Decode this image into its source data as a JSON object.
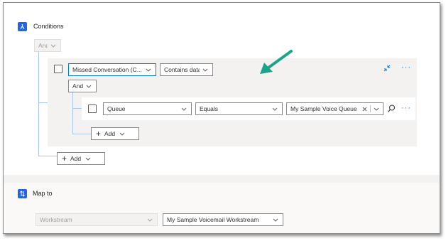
{
  "conditions": {
    "title": "Conditions",
    "top_operator": "And",
    "add_button_label": "Add",
    "group": {
      "field_value": "Missed Conversation (C...",
      "operator_value": "Contains data",
      "inner_operator": "And",
      "add_button_label": "Add",
      "row": {
        "field_value": "Queue",
        "operator_value": "Equals",
        "value_tag": "My Sample Voice Queue"
      }
    }
  },
  "map_to": {
    "title": "Map to",
    "workstream_placeholder": "Workstream",
    "workstream_value": "My Sample Voicemail Workstream"
  },
  "colors": {
    "accent": "#0078d4",
    "annotation_arrow": "#1aa58a"
  }
}
